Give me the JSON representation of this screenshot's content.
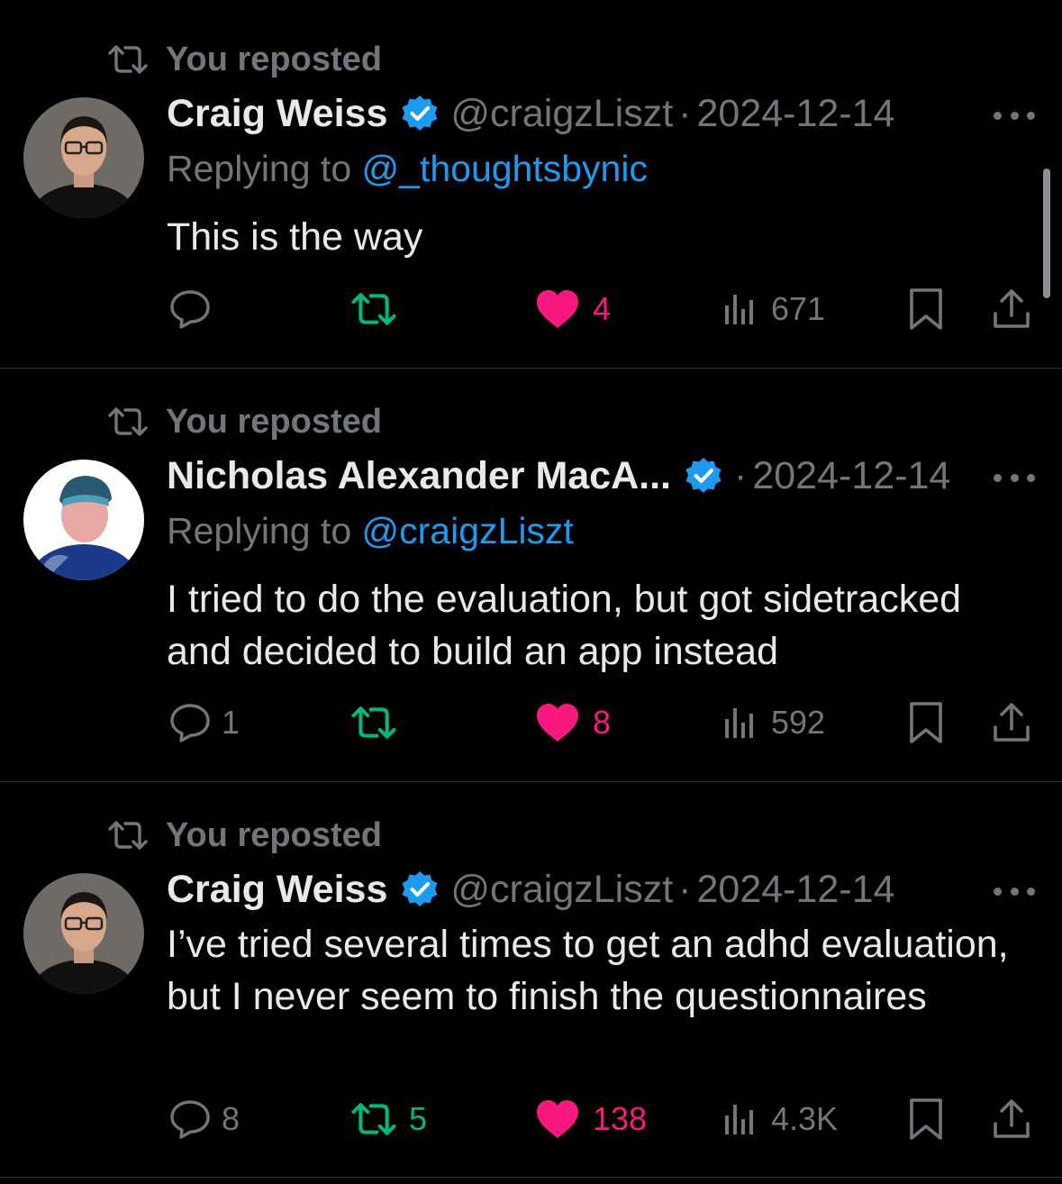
{
  "repost_label": "You reposted",
  "colors": {
    "background": "#000000",
    "text_primary": "#e7e9ea",
    "text_secondary": "#71767b",
    "link_blue": "#1d9bf0",
    "verified_blue": "#1d9bf0",
    "retweet_green": "#00ba7c",
    "like_pink": "#f91880",
    "divider": "#2f3336"
  },
  "icons": {
    "repost": "repost-icon",
    "verified": "verified-badge-icon",
    "more": "more-options-icon",
    "reply": "reply-icon",
    "like": "heart-icon",
    "views": "views-icon",
    "bookmark": "bookmark-icon",
    "share": "share-icon"
  },
  "posts": [
    {
      "author_name": "Craig Weiss",
      "handle": "@craigzLiszt",
      "separator": "·",
      "date": "2024-12-14",
      "replying_prefix": "Replying to",
      "replying_to": "@_thoughtsbynic",
      "text": "This is the way",
      "reply_count": "",
      "repost_count": "",
      "like_count": "4",
      "view_count": "671"
    },
    {
      "author_name": "Nicholas Alexander MacA...",
      "handle": "",
      "separator": "·",
      "date": "2024-12-14",
      "replying_prefix": "Replying to",
      "replying_to": "@craigzLiszt",
      "text": "I tried to do the evaluation, but got sidetracked and decided to build an app instead",
      "reply_count": "1",
      "repost_count": "",
      "like_count": "8",
      "view_count": "592"
    },
    {
      "author_name": "Craig Weiss",
      "handle": "@craigzLiszt",
      "separator": "·",
      "date": "2024-12-14",
      "replying_prefix": "",
      "replying_to": "",
      "text": "I’ve tried several times to get an adhd evaluation, but I never seem to finish the questionnaires",
      "reply_count": "8",
      "repost_count": "5",
      "like_count": "138",
      "view_count": "4.3K"
    }
  ]
}
